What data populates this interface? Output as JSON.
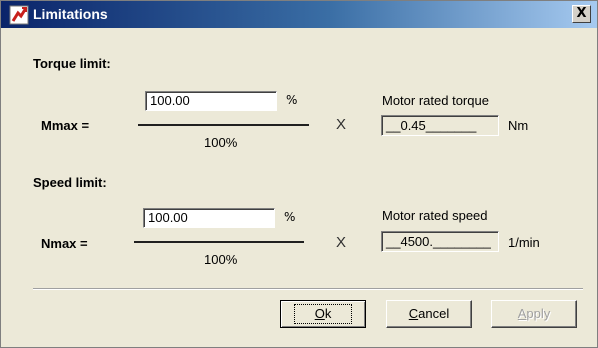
{
  "window": {
    "title": "Limitations",
    "close_label": "X"
  },
  "torque": {
    "section_title": "Torque limit:",
    "var_label": "Mmax =",
    "input_value": "100.00",
    "input_unit": "%",
    "denominator": "100%",
    "times": "X",
    "ref_label": "Motor rated torque",
    "ref_value": "__0.45_______",
    "ref_unit": "Nm"
  },
  "speed": {
    "section_title": "Speed limit:",
    "var_label": "Nmax =",
    "input_value": "100.00",
    "input_unit": "%",
    "denominator": "100%",
    "times": "X",
    "ref_label": "Motor rated speed",
    "ref_value": "__4500.________",
    "ref_unit": "1/min"
  },
  "buttons": {
    "ok": {
      "mnemonic": "O",
      "rest": "k"
    },
    "cancel": {
      "mnemonic": "C",
      "rest": "ancel"
    },
    "apply": {
      "mnemonic": "A",
      "rest": "pply",
      "enabled": false
    }
  },
  "colors": {
    "titlebar_start": "#0a246a",
    "titlebar_end": "#a6caf0",
    "face": "#ece9d8",
    "icon_red": "#c8201c"
  },
  "icons": {
    "app": "limit-tool-icon",
    "close": "close-icon"
  }
}
